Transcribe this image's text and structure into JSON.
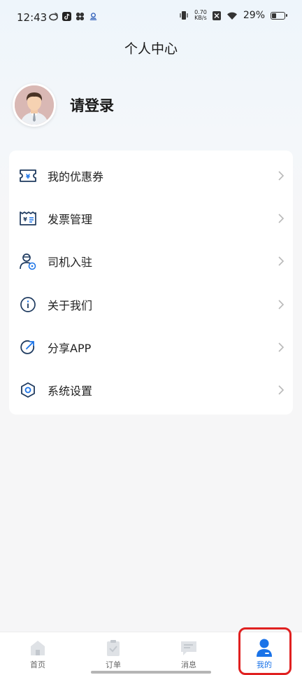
{
  "status_bar": {
    "time": "12:43",
    "net_speed_value": "0.70",
    "net_speed_unit": "KB/s",
    "battery_percent": "29%",
    "battery_level": 0.29,
    "left_icons": [
      "weibo-icon",
      "tiktok-icon",
      "clover-icon",
      "app-icon"
    ],
    "right_icons": [
      "vibrate-icon",
      "network-speed",
      "no-sim-icon",
      "wifi-icon",
      "battery-icon"
    ]
  },
  "header": {
    "title": "个人中心"
  },
  "profile": {
    "login_text": "请登录",
    "avatar_icon": "avatar-icon"
  },
  "menu": {
    "items": [
      {
        "label": "我的优惠券",
        "icon": "coupon-icon"
      },
      {
        "label": "发票管理",
        "icon": "invoice-icon"
      },
      {
        "label": "司机入驻",
        "icon": "driver-icon"
      },
      {
        "label": "关于我们",
        "icon": "info-icon"
      },
      {
        "label": "分享APP",
        "icon": "share-icon"
      },
      {
        "label": "系统设置",
        "icon": "settings-icon"
      }
    ]
  },
  "tabs": [
    {
      "label": "首页",
      "icon": "home-icon",
      "active": false
    },
    {
      "label": "订单",
      "icon": "order-icon",
      "active": false
    },
    {
      "label": "消息",
      "icon": "message-icon",
      "active": false
    },
    {
      "label": "我的",
      "icon": "profile-icon",
      "active": true
    }
  ],
  "colors": {
    "accent": "#1a73e8",
    "highlight": "#e02020",
    "icon_dark": "#1e3a5f"
  }
}
